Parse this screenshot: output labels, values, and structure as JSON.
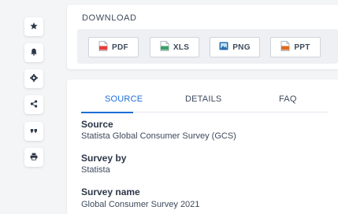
{
  "rail": {
    "buttons": [
      {
        "icon": "star-icon"
      },
      {
        "icon": "bell-icon"
      },
      {
        "icon": "gear-icon"
      },
      {
        "icon": "share-icon"
      },
      {
        "icon": "quote-icon"
      },
      {
        "icon": "print-icon"
      }
    ]
  },
  "download": {
    "title": "DOWNLOAD",
    "buttons": [
      {
        "label": "PDF",
        "icon": "pdf-file-icon",
        "color": "#e53e3e"
      },
      {
        "label": "XLS",
        "icon": "xls-file-icon",
        "color": "#38a169"
      },
      {
        "label": "PNG",
        "icon": "png-image-icon",
        "color": "#2b6cb0"
      },
      {
        "label": "PPT",
        "icon": "ppt-file-icon",
        "color": "#dd6b20"
      }
    ]
  },
  "tabs": [
    "SOURCE",
    "DETAILS",
    "FAQ"
  ],
  "info": {
    "source_label": "Source",
    "source_value": "Statista Global Consumer Survey (GCS)",
    "survey_by_label": "Survey by",
    "survey_by_value": "Statista",
    "survey_name_label": "Survey name",
    "survey_name_value": "Global Consumer Survey 2021"
  },
  "colors": {
    "accent": "#1c6ed8",
    "background": "#f4f5f7"
  }
}
